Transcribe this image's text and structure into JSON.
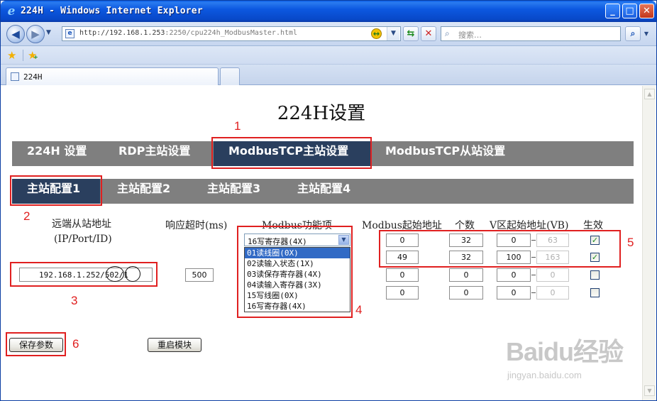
{
  "window": {
    "title": "224H - Windows Internet Explorer",
    "min": "_",
    "max": "□",
    "close": "✕",
    "brand_icon": "e"
  },
  "address_bar": {
    "url_host": "http://192.168.1.253",
    "url_rest": ":2250/cpu224h_ModbusMaster.html",
    "back": "◀",
    "forward": "▶",
    "nav_dropdown": "▼",
    "url_dropdown": "▼",
    "compat_icon": "↔",
    "refresh": "⇆",
    "stop": "✕",
    "search_placeholder": "搜索…",
    "search_icon": "⌕",
    "search_go": "⌕",
    "search_dropdown": "▼"
  },
  "favorites": {
    "star": "★",
    "add": "★",
    "add_plus": "+"
  },
  "tabs": [
    {
      "label": "224H"
    }
  ],
  "page": {
    "title": "224H设置",
    "main_nav": [
      "224H 设置",
      "RDP主站设置",
      "ModbusTCP主站设置",
      "ModbusTCP从站设置"
    ],
    "sub_nav": [
      "主站配置1",
      "主站配置2",
      "主站配置3",
      "主站配置4"
    ],
    "columns": {
      "remote_addr": "远端从站地址",
      "remote_addr_sub": "(IP/Port/ID)",
      "timeout": "响应超时(ms)",
      "function": "Modbus功能项",
      "start_addr": "Modbus起始地址",
      "count": "个数",
      "v_start": "V区起始地址(VB)",
      "enable": "生效"
    },
    "remote": {
      "ip": "192.168.1.252",
      "port": "502",
      "id": "1",
      "sep": "/"
    },
    "timeout_value": "500",
    "function_select": {
      "selected": "16写寄存器(4X)",
      "options": [
        "01读线圈(0X)",
        "02读输入状态(1X)",
        "03读保存寄存器(4X)",
        "04读输入寄存器(3X)",
        "15写线圈(0X)",
        "16写寄存器(4X)"
      ],
      "highlighted_index": 0
    },
    "rows": [
      {
        "modbus_start": "0",
        "count": "32",
        "v_start": "0",
        "v_end": "63",
        "enabled": true
      },
      {
        "modbus_start": "49",
        "count": "32",
        "v_start": "100",
        "v_end": "163",
        "enabled": true
      },
      {
        "modbus_start": "0",
        "count": "0",
        "v_start": "0",
        "v_end": "0",
        "enabled": false
      },
      {
        "modbus_start": "0",
        "count": "0",
        "v_start": "0",
        "v_end": "0",
        "enabled": false
      }
    ],
    "buttons": {
      "save": "保存参数",
      "restart": "重启模块"
    },
    "checkmark": "✓"
  },
  "annotations": [
    "1",
    "2",
    "3",
    "4",
    "5",
    "6"
  ],
  "scroll": {
    "up": "▲",
    "down": "▼"
  },
  "watermark": {
    "logo": "Baidu经验",
    "sub": "jingyan.baidu.com"
  },
  "colors": {
    "nav_bar": "#7f7f7f",
    "nav_active": "#2a3f5e",
    "annotation": "#e02020",
    "titlebar": "#0c58e0"
  }
}
